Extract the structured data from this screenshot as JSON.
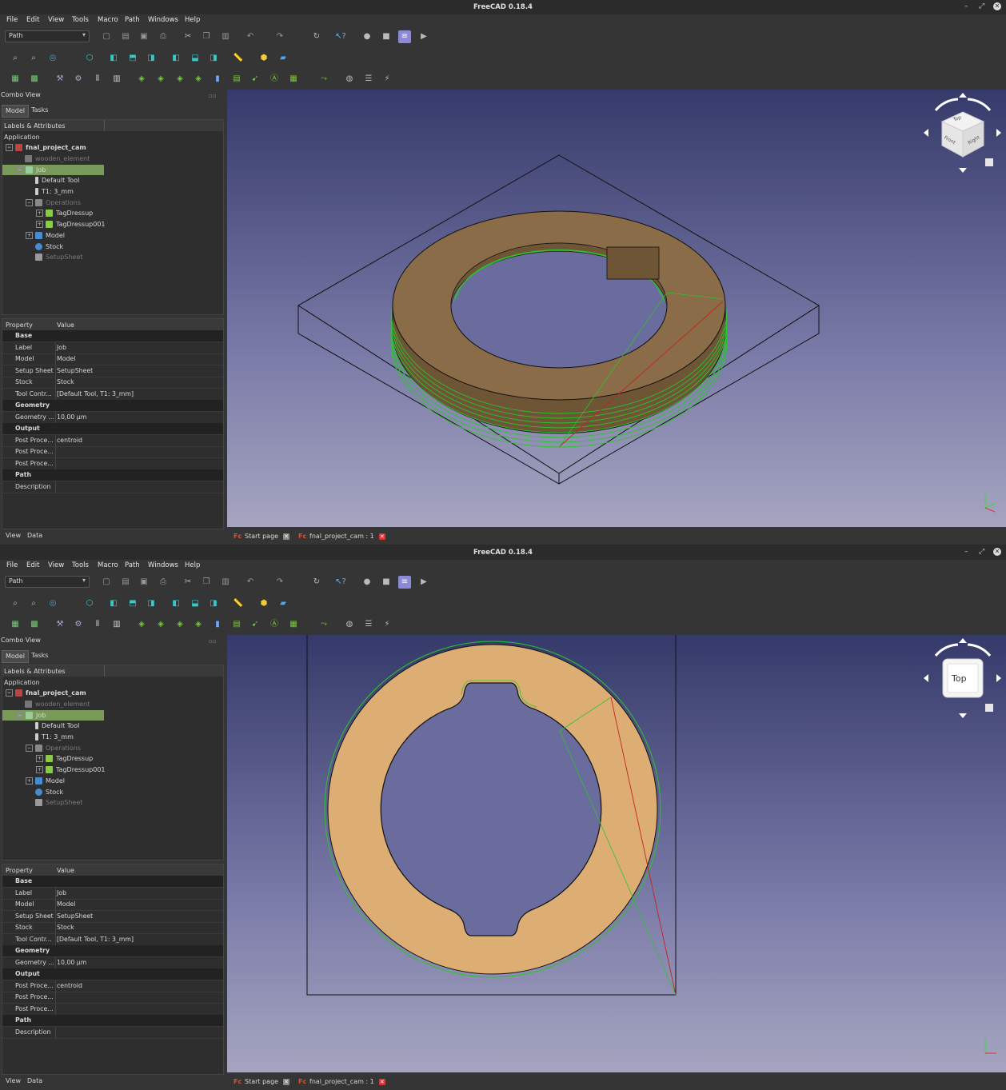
{
  "app_title": "FreeCAD 0.18.4",
  "menu": [
    "File",
    "Edit",
    "View",
    "Tools",
    "Macro",
    "Path",
    "Windows",
    "Help"
  ],
  "workbench": "Path",
  "combo_view": {
    "title": "Combo View",
    "tabs": [
      "Model",
      "Tasks"
    ],
    "tree_header": "Labels & Attributes",
    "tree": {
      "application": "Application",
      "document": "fnal_project_cam",
      "wooden": "wooden_element",
      "job": "Job",
      "default_tool": "Default Tool",
      "tool_t1": "T1: 3_mm",
      "operations": "Operations",
      "tagdressup": "TagDressup",
      "tagdressup001": "TagDressup001",
      "model": "Model",
      "stock": "Stock",
      "setupsheet": "SetupSheet"
    },
    "property_header": {
      "property": "Property",
      "value": "Value"
    },
    "groups": {
      "base": "Base",
      "geometry": "Geometry",
      "output": "Output",
      "path": "Path"
    },
    "props": {
      "label_k": "Label",
      "label_v": "Job",
      "model_k": "Model",
      "model_v": "Model",
      "setup_k": "Setup Sheet",
      "setup_v": "SetupSheet",
      "stock_k": "Stock",
      "stock_v": "Stock",
      "toolc_k": "Tool Contr...",
      "toolc_v": "[Default Tool, T1: 3_mm]",
      "geom_k": "Geometry ...",
      "geom_v": "10,00 µm",
      "post1_k": "Post Proce...",
      "post1_v": "centroid",
      "post2_k": "Post Proce...",
      "post3_k": "Post Proce...",
      "desc_k": "Description"
    },
    "bottom_tabs": [
      "View",
      "Data"
    ]
  },
  "doc_tabs": [
    "Start page",
    "fnal_project_cam : 1"
  ],
  "navcube": {
    "iso_faces": [
      "Top",
      "Front",
      "Right"
    ],
    "top_face": "Top"
  },
  "colors": {
    "part": "#8a6c48",
    "part_top": "#dcae74",
    "toolpath": "#22bb22",
    "rapid": "#cc2020",
    "selection": "#7a9a5a"
  }
}
